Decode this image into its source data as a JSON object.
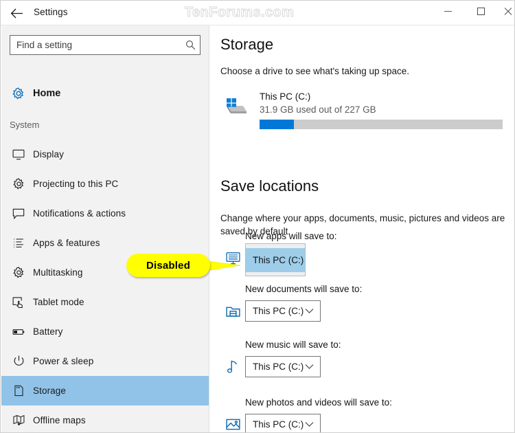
{
  "window": {
    "title": "Settings",
    "watermark": "TenForums.com",
    "back_icon": "back-arrow-icon",
    "controls": {
      "minimize": "minimize-icon",
      "maximize": "maximize-icon",
      "close": "close-icon"
    }
  },
  "sidebar": {
    "search": {
      "placeholder": "Find a setting",
      "value": "",
      "icon": "search-icon"
    },
    "home": {
      "label": "Home",
      "icon": "gear-icon"
    },
    "group_header": "System",
    "items": [
      {
        "label": "Display",
        "icon": "monitor-icon",
        "selected": false
      },
      {
        "label": "Projecting to this PC",
        "icon": "gear-icon",
        "selected": false
      },
      {
        "label": "Notifications & actions",
        "icon": "speech-bubble-icon",
        "selected": false
      },
      {
        "label": "Apps & features",
        "icon": "list-icon",
        "selected": false
      },
      {
        "label": "Multitasking",
        "icon": "gear-icon",
        "selected": false
      },
      {
        "label": "Tablet mode",
        "icon": "tablet-hand-icon",
        "selected": false
      },
      {
        "label": "Battery",
        "icon": "battery-icon",
        "selected": false
      },
      {
        "label": "Power & sleep",
        "icon": "power-icon",
        "selected": false
      },
      {
        "label": "Storage",
        "icon": "storage-card-icon",
        "selected": true
      },
      {
        "label": "Offline maps",
        "icon": "map-download-icon",
        "selected": false
      }
    ]
  },
  "main": {
    "storage": {
      "heading": "Storage",
      "subtitle": "Choose a drive to see what's taking up space.",
      "drive": {
        "icon": "hard-drive-icon",
        "name": "This PC (C:)",
        "usage": "31.9 GB used out of 227 GB",
        "used_gb": 31.9,
        "total_gb": 227,
        "percent_used": 14,
        "bar_color": "#0078d7",
        "bar_track_color": "#cccccc"
      }
    },
    "save_locations": {
      "heading": "Save locations",
      "description": "Change where your apps, documents, music, pictures and videos are saved by default.",
      "entries": [
        {
          "label": "New apps will save to:",
          "icon": "app-monitor-icon",
          "value": "This PC (C:)",
          "state": "disabled-open",
          "has_chevron": false
        },
        {
          "label": "New documents will save to:",
          "icon": "documents-folder-icon",
          "value": "This PC (C:)",
          "state": "enabled",
          "has_chevron": true
        },
        {
          "label": "New music will save to:",
          "icon": "music-note-icon",
          "value": "This PC (C:)",
          "state": "enabled",
          "has_chevron": true
        },
        {
          "label": "New photos and videos will save to:",
          "icon": "picture-icon",
          "value": "This PC (C:)",
          "state": "enabled",
          "has_chevron": true
        }
      ]
    }
  },
  "callout": {
    "text": "Disabled",
    "fill_color": "#ffff00",
    "text_color": "#000000"
  },
  "colors": {
    "accent_blue": "#0078d7",
    "selection_blue": "#91c3e8",
    "sidebar_bg": "#f2f2f2",
    "icon_blue": "#0c6cb5"
  }
}
